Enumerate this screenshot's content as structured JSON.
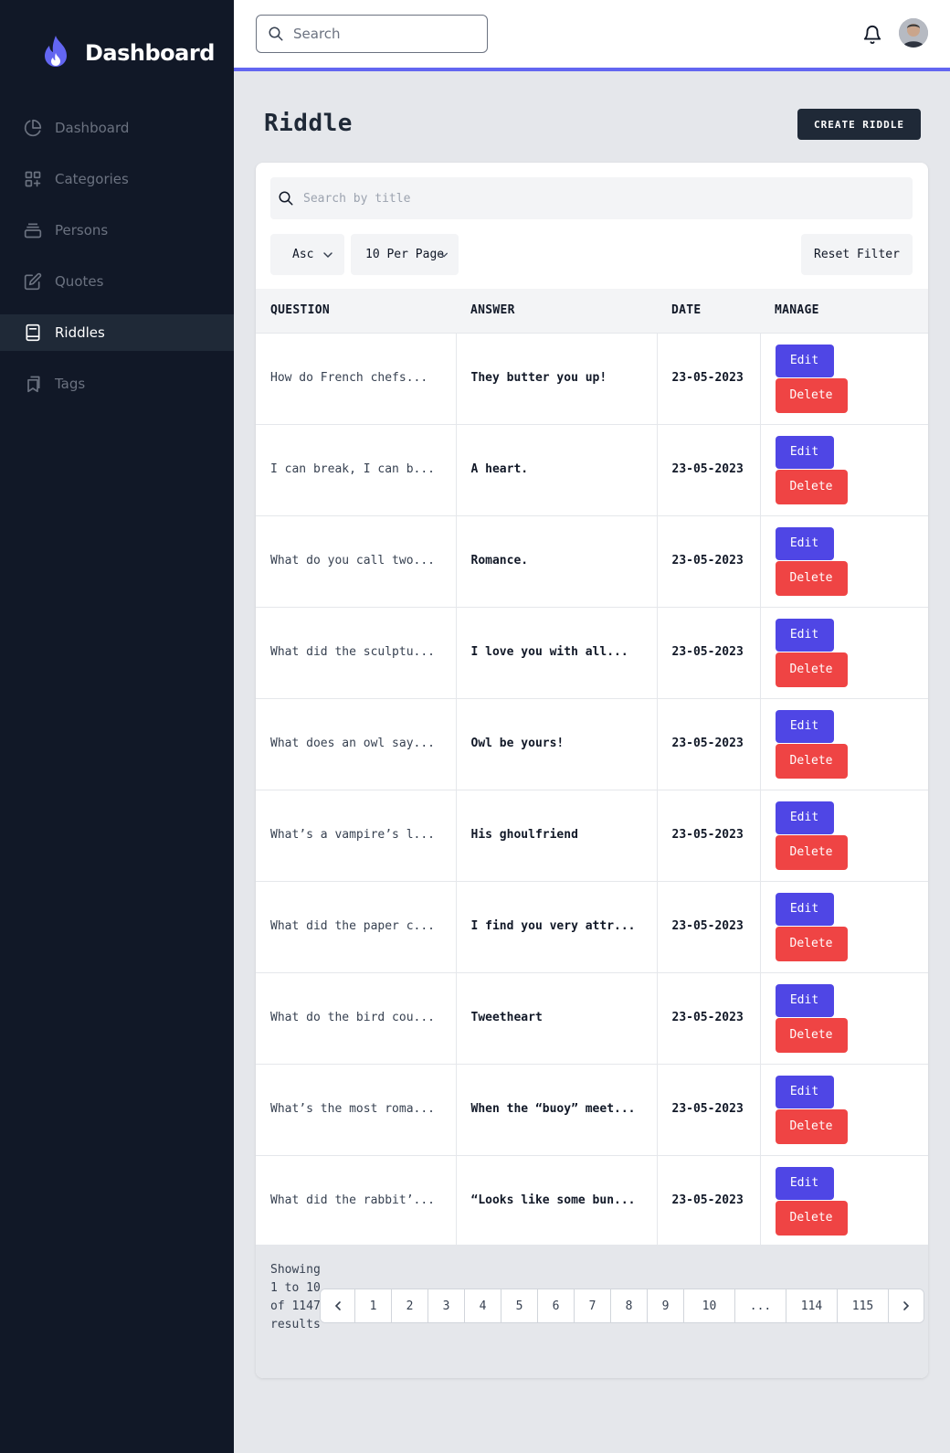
{
  "colors": {
    "sidebar_bg": "#111827",
    "accent": "#4f46e5",
    "danger": "#ef4444",
    "topbar_border": "#6366f1"
  },
  "sidebar": {
    "brand": "Dashboard",
    "brand_icon": "flame-icon",
    "items": [
      {
        "label": "Dashboard",
        "icon": "pie-chart-icon",
        "active": false
      },
      {
        "label": "Categories",
        "icon": "grid-plus-icon",
        "active": false
      },
      {
        "label": "Persons",
        "icon": "archive-icon",
        "active": false
      },
      {
        "label": "Quotes",
        "icon": "edit-icon",
        "active": false
      },
      {
        "label": "Riddles",
        "icon": "book-icon",
        "active": true
      },
      {
        "label": "Tags",
        "icon": "bookmark-icon",
        "active": false
      }
    ]
  },
  "topbar": {
    "search_placeholder": "Search"
  },
  "page": {
    "title": "Riddle",
    "create_button": "CREATE RIDDLE"
  },
  "filters": {
    "title_search_placeholder": "Search by title",
    "order_value": "Asc",
    "per_page_value": "10 Per Page",
    "reset_label": "Reset Filter"
  },
  "table": {
    "headers": [
      "QUESTION",
      "ANSWER",
      "DATE",
      "MANAGE"
    ],
    "edit_label": "Edit",
    "delete_label": "Delete",
    "rows": [
      {
        "question": "How do French chefs...",
        "answer": "They butter you up!",
        "date": "23-05-2023"
      },
      {
        "question": "I can break, I can b...",
        "answer": "A heart.",
        "date": "23-05-2023"
      },
      {
        "question": "What do you call two...",
        "answer": "Romance.",
        "date": "23-05-2023"
      },
      {
        "question": "What did the sculptu...",
        "answer": "I love you with all...",
        "date": "23-05-2023"
      },
      {
        "question": "What does an owl say...",
        "answer": "Owl be yours!",
        "date": "23-05-2023"
      },
      {
        "question": "What’s a vampire’s l...",
        "answer": "His ghoulfriend",
        "date": "23-05-2023"
      },
      {
        "question": "What did the paper c...",
        "answer": "I find you very attr...",
        "date": "23-05-2023"
      },
      {
        "question": "What do the bird cou...",
        "answer": "Tweetheart",
        "date": "23-05-2023"
      },
      {
        "question": "What’s the most roma...",
        "answer": "When the “buoy” meet...",
        "date": "23-05-2023"
      },
      {
        "question": "What did the rabbit’...",
        "answer": "“Looks like some bun...",
        "date": "23-05-2023"
      }
    ]
  },
  "pagination": {
    "showing_text": "Showing 1 to 10 of 1147 results",
    "pages": [
      "1",
      "2",
      "3",
      "4",
      "5",
      "6",
      "7",
      "8",
      "9",
      "10",
      "...",
      "114",
      "115"
    ]
  }
}
